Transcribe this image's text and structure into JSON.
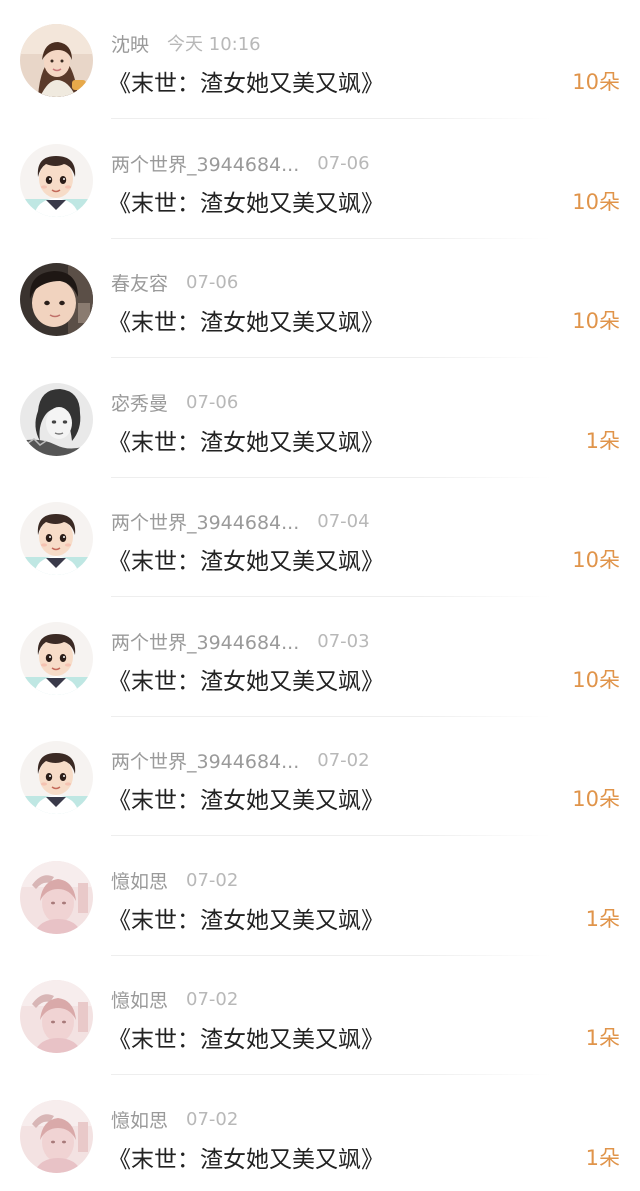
{
  "items": [
    {
      "name": "沈映",
      "time": "今天 10:16",
      "title": "《末世：渣女她又美又飒》",
      "amount": "10朵",
      "avatar": "girl-photo-avatar"
    },
    {
      "name": "两个世界_3944684...",
      "time": "07-06",
      "title": "《末世：渣女她又美又飒》",
      "amount": "10朵",
      "avatar": "cartoon-boy-avatar"
    },
    {
      "name": "春友容",
      "time": "07-06",
      "title": "《末世：渣女她又美又飒》",
      "amount": "10朵",
      "avatar": "child-photo-avatar"
    },
    {
      "name": "宓秀曼",
      "time": "07-06",
      "title": "《末世：渣女她又美又飒》",
      "amount": "1朵",
      "avatar": "grayscale-photo-avatar"
    },
    {
      "name": "两个世界_3944684...",
      "time": "07-04",
      "title": "《末世：渣女她又美又飒》",
      "amount": "10朵",
      "avatar": "cartoon-boy-avatar"
    },
    {
      "name": "两个世界_3944684...",
      "time": "07-03",
      "title": "《末世：渣女她又美又飒》",
      "amount": "10朵",
      "avatar": "cartoon-boy-avatar"
    },
    {
      "name": "两个世界_3944684...",
      "time": "07-02",
      "title": "《末世：渣女她又美又飒》",
      "amount": "10朵",
      "avatar": "cartoon-boy-avatar"
    },
    {
      "name": "憶如思",
      "time": "07-02",
      "title": "《末世：渣女她又美又飒》",
      "amount": "1朵",
      "avatar": "pink-photo-avatar"
    },
    {
      "name": "憶如思",
      "time": "07-02",
      "title": "《末世：渣女她又美又飒》",
      "amount": "1朵",
      "avatar": "pink-photo-avatar"
    },
    {
      "name": "憶如思",
      "time": "07-02",
      "title": "《末世：渣女她又美又飒》",
      "amount": "1朵",
      "avatar": "pink-photo-avatar"
    }
  ],
  "colors": {
    "amount": "#e0944a",
    "name": "#9a9a9a",
    "time": "#b8b8b8",
    "title": "#222222",
    "divider": "#eeeeee"
  }
}
